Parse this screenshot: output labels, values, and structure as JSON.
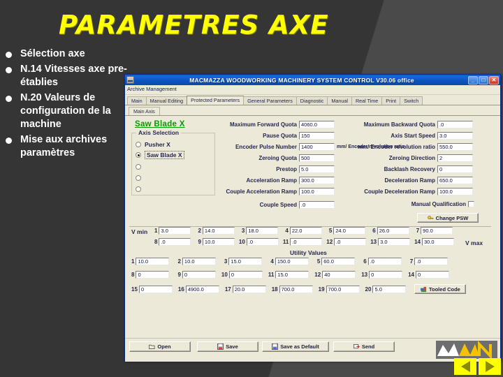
{
  "slide": {
    "title": "PARAMETRES AXE",
    "title_color": "#ffff00",
    "bullets": [
      "Sélection axe",
      "N.14 Vitesses axe pre-établies",
      "N.20 Valeurs de configuration de la machine",
      "Mise aux archives paramètres"
    ]
  },
  "app": {
    "titlebar": {
      "title": "MACMAZZA WOODWORKING MACHINERY SYSTEM CONTROL  V30.06 office",
      "minimize": "_",
      "maximize": "□",
      "close": "✕"
    },
    "menubar": {
      "items": [
        "Archive Management"
      ]
    },
    "tabs": [
      {
        "label": "Main",
        "active": false
      },
      {
        "label": "Manual Editing",
        "active": false
      },
      {
        "label": "Protected Parameters",
        "active": true
      },
      {
        "label": "General Parameters",
        "active": false
      },
      {
        "label": "Diagnostic",
        "active": false
      },
      {
        "label": "Manual",
        "active": false
      },
      {
        "label": "Real Time",
        "active": false
      },
      {
        "label": "Print",
        "active": false
      },
      {
        "label": "Switch",
        "active": false
      }
    ],
    "subtabs": [
      {
        "label": "Main Axis",
        "active": true
      }
    ],
    "axis_panel": {
      "heading": "Saw Blade X",
      "heading_color": "#00a000",
      "group_title": "Axis Selection",
      "options": [
        {
          "label": "Pusher X",
          "selected": false
        },
        {
          "label": "Saw Blade X",
          "selected": true
        },
        {
          "label": "",
          "selected": false
        },
        {
          "label": "",
          "selected": false
        },
        {
          "label": "",
          "selected": false
        }
      ]
    },
    "params_left": [
      {
        "label": "Maximum Forward Quota",
        "value": "4060.0",
        "unit": ""
      },
      {
        "label": "Pause Quota",
        "value": "150",
        "unit": ""
      },
      {
        "label": "Encoder Pulse Number",
        "value": "1400",
        "unit": "mm/ Encoder revolution ratio"
      },
      {
        "label": "Zeroing Quota",
        "value": "500",
        "unit": ""
      },
      {
        "label": "Prestop",
        "value": "5.0",
        "unit": ""
      },
      {
        "label": "Acceleration Ramp",
        "value": "300.0",
        "unit": ""
      },
      {
        "label": "Couple Acceleration Ramp",
        "value": "100.0",
        "unit": ""
      },
      {
        "label": "Couple Speed",
        "value": ".0",
        "unit": ""
      }
    ],
    "params_right": [
      {
        "label": "Maximum Backward Quota",
        "value": ".0"
      },
      {
        "label": "Axis Start Speed",
        "value": "3.0"
      },
      {
        "label": "mm/ Encoder revolution ratio",
        "value": "550.0"
      },
      {
        "label": "Zeroing Direction",
        "value": "2"
      },
      {
        "label": "Backlash Recovery",
        "value": "0"
      },
      {
        "label": "Deceleration Ramp",
        "value": "650.0"
      },
      {
        "label": "Couple Deceleration Ramp",
        "value": "100.0"
      }
    ],
    "manual_qualification": {
      "label": "Manual Qualification",
      "checked": false
    },
    "change_psw_button": {
      "label": "Change PSW",
      "icon": "key-icon"
    },
    "speeds": {
      "vmin_label": "V min",
      "vmax_label": "V max",
      "row1": [
        {
          "n": "1",
          "v": "3.0"
        },
        {
          "n": "2",
          "v": "14.0"
        },
        {
          "n": "3",
          "v": "18.0"
        },
        {
          "n": "4",
          "v": "22.0"
        },
        {
          "n": "5",
          "v": "24.0"
        },
        {
          "n": "6",
          "v": "26.0"
        },
        {
          "n": "7",
          "v": "90.0"
        }
      ],
      "row2": [
        {
          "n": "8",
          "v": ".0"
        },
        {
          "n": "9",
          "v": "10.0"
        },
        {
          "n": "10",
          "v": ".0"
        },
        {
          "n": "11",
          "v": ".0"
        },
        {
          "n": "12",
          "v": ".0"
        },
        {
          "n": "13",
          "v": "3.0"
        },
        {
          "n": "14",
          "v": "30.0"
        }
      ]
    },
    "utility": {
      "title": "Utility Values",
      "row1": [
        {
          "n": "1",
          "v": "10.0"
        },
        {
          "n": "2",
          "v": "10.0"
        },
        {
          "n": "3",
          "v": "15.0"
        },
        {
          "n": "4",
          "v": "150.0"
        },
        {
          "n": "5",
          "v": "60.0"
        },
        {
          "n": "6",
          "v": ".0"
        },
        {
          "n": "7",
          "v": ".0"
        }
      ],
      "row2": [
        {
          "n": "8",
          "v": "0"
        },
        {
          "n": "9",
          "v": "0"
        },
        {
          "n": "10",
          "v": "0"
        },
        {
          "n": "11",
          "v": "15.0"
        },
        {
          "n": "12",
          "v": "40"
        },
        {
          "n": "13",
          "v": "0"
        },
        {
          "n": "14",
          "v": "0"
        }
      ],
      "row3": [
        {
          "n": "15",
          "v": "0"
        },
        {
          "n": "16",
          "v": "4900.0"
        },
        {
          "n": "17",
          "v": "20.0"
        },
        {
          "n": "18",
          "v": "700.0"
        },
        {
          "n": "19",
          "v": "700.0"
        },
        {
          "n": "20",
          "v": "5.0"
        }
      ],
      "code_button": {
        "label": "Tooled Code",
        "icon": "tools-icon"
      }
    },
    "bottom_buttons": [
      {
        "label": "Open",
        "icon": "folder-open-icon"
      },
      {
        "label": "Save",
        "icon": "floppy-save-icon"
      },
      {
        "label": "Save as Default",
        "icon": "floppy-default-icon"
      },
      {
        "label": "Send",
        "icon": "send-icon"
      }
    ],
    "logo_text": "MN"
  },
  "slide_nav": {
    "prev": "previous-slide",
    "next": "next-slide"
  }
}
